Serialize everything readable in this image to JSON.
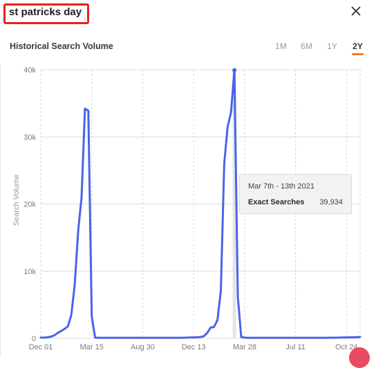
{
  "header": {
    "title": "st patricks day",
    "close_icon": "close-icon"
  },
  "panel": {
    "subtitle": "Historical Search Volume",
    "range_tabs": [
      {
        "label": "1M",
        "active": false
      },
      {
        "label": "6M",
        "active": false
      },
      {
        "label": "1Y",
        "active": false
      },
      {
        "label": "2Y",
        "active": true
      }
    ]
  },
  "colors": {
    "line": "#4a63e6",
    "accent": "#f27c2a",
    "highlight_box": "#e8201c"
  },
  "tooltip": {
    "date": "Mar 7th - 13th 2021",
    "label": "Exact Searches",
    "value": "39,934"
  },
  "chart_data": {
    "type": "line",
    "title": "Historical Search Volume",
    "xlabel": "",
    "ylabel": "Search Volume",
    "ylim": [
      0,
      40000
    ],
    "yticks": [
      0,
      10000,
      20000,
      30000,
      40000
    ],
    "ytick_labels": [
      "0",
      "10k",
      "20k",
      "30k",
      "40k"
    ],
    "xtick_labels": [
      "Dec 01",
      "Mar 15",
      "Aug 30",
      "Dec 13",
      "Mar 28",
      "Jul 11",
      "Oct 24"
    ],
    "xtick_indices": [
      0,
      15,
      30,
      45,
      60,
      75,
      90
    ],
    "grid": true,
    "highlight_index": 57,
    "series": [
      {
        "name": "Exact Searches",
        "values": [
          100,
          100,
          150,
          250,
          450,
          800,
          1100,
          1400,
          1800,
          3500,
          8000,
          16000,
          21000,
          34200,
          33900,
          3300,
          100,
          80,
          80,
          70,
          70,
          70,
          70,
          70,
          70,
          70,
          70,
          70,
          70,
          70,
          70,
          70,
          70,
          70,
          70,
          70,
          70,
          70,
          70,
          70,
          80,
          80,
          90,
          100,
          120,
          130,
          150,
          200,
          300,
          800,
          1600,
          1700,
          2700,
          7000,
          26000,
          31500,
          33600,
          39934,
          6200,
          200,
          100,
          80,
          80,
          70,
          70,
          70,
          70,
          70,
          70,
          70,
          70,
          70,
          70,
          70,
          70,
          70,
          70,
          70,
          70,
          70,
          70,
          70,
          80,
          80,
          80,
          90,
          90,
          100,
          100,
          120,
          130,
          140,
          150,
          160,
          200
        ]
      }
    ]
  }
}
